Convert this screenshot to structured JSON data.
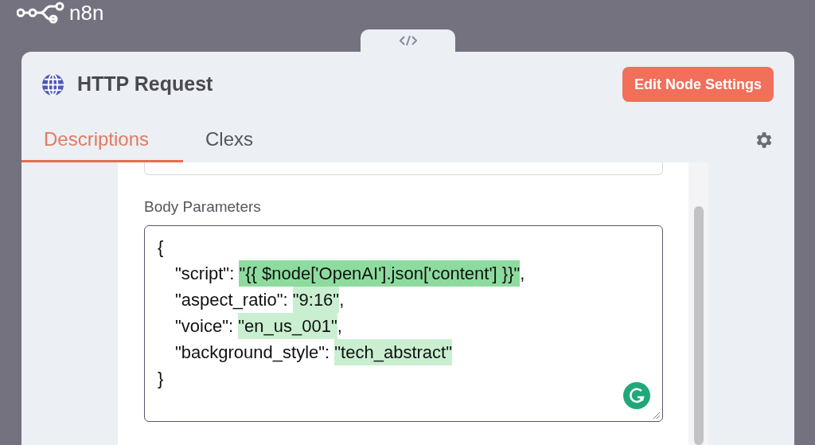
{
  "app": {
    "logo_text": "n8n"
  },
  "node": {
    "title": "HTTP Request",
    "action": "Edit Node Settings"
  },
  "tabs": [
    {
      "label": "Descriptions",
      "selected": true
    },
    {
      "label": "Clexs",
      "selected": false
    }
  ],
  "body_parameters": {
    "label": "Body Parameters",
    "open": "{",
    "close": "}",
    "entries": [
      {
        "key": "\"script\":",
        "value": "\"{{ $node['OpenAI'].json['content'] }}\"",
        "trail": ",",
        "color": "#8edb9f"
      },
      {
        "key": "\"aspect_ratio\":",
        "value": "\"9:16\"",
        "trail": ",",
        "color": "#c9efd0"
      },
      {
        "key": "\"voice\":",
        "value": "\"en_us_001\"",
        "trail": ",",
        "color": "#c9efd0"
      },
      {
        "key": "\"background_style\":",
        "value": "\"tech_abstract\"",
        "color": "#c9efd0"
      }
    ]
  }
}
